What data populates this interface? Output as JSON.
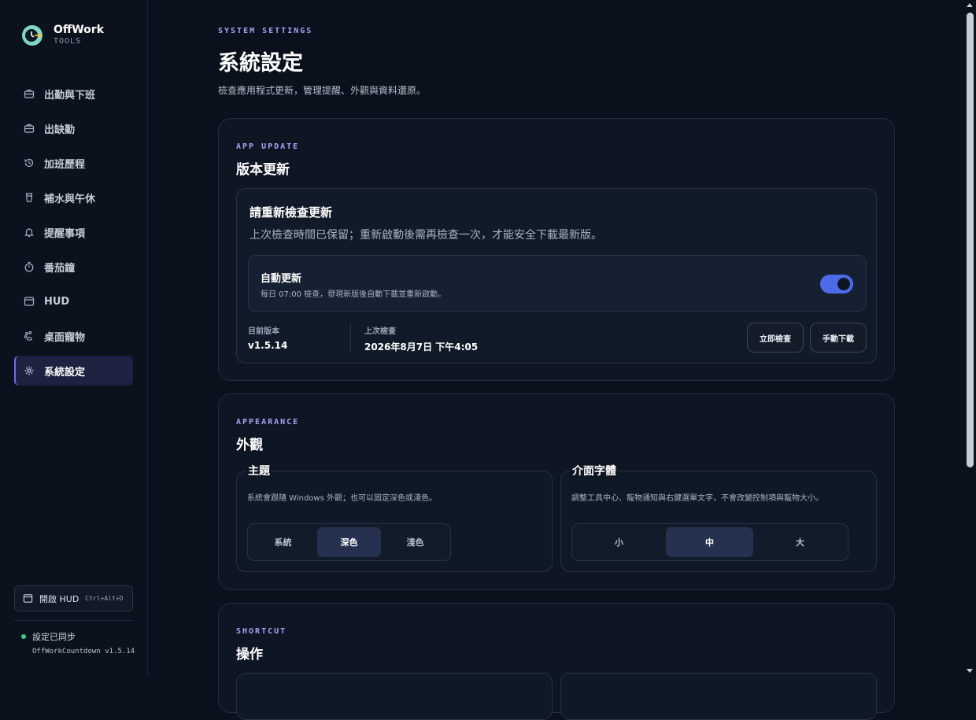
{
  "brand": {
    "name": "OffWork",
    "sub": "TOOLS"
  },
  "nav": [
    {
      "label": "出勤與下班",
      "icon": "briefcase-icon"
    },
    {
      "label": "出缺勤",
      "icon": "briefcase-icon"
    },
    {
      "label": "加班歷程",
      "icon": "history-icon"
    },
    {
      "label": "補水與午休",
      "icon": "cup-icon"
    },
    {
      "label": "提醒事項",
      "icon": "bell-icon"
    },
    {
      "label": "番茄鐘",
      "icon": "timer-icon"
    },
    {
      "label": "HUD",
      "icon": "window-icon"
    },
    {
      "label": "桌面寵物",
      "icon": "pet-icon"
    },
    {
      "label": "系統設定",
      "icon": "gear-icon",
      "active": true
    }
  ],
  "sidebar_footer": {
    "hud_label": "開啟 HUD",
    "hud_shortcut": "Ctrl+Alt+D",
    "sync_status": "設定已同步",
    "version": "OffWorkCountdown v1.5.14"
  },
  "page": {
    "eyebrow": "SYSTEM SETTINGS",
    "title": "系統設定",
    "description": "檢查應用程式更新，管理提醒、外觀與資料還原。"
  },
  "update": {
    "eyebrow": "APP UPDATE",
    "title": "版本更新",
    "notice_title": "請重新檢查更新",
    "notice_desc": "上次檢查時間已保留；重新啟動後需再檢查一次，才能安全下載最新版。",
    "auto_title": "自動更新",
    "auto_desc": "每日 07:00 檢查，發現新版後自動下載並重新啟動。",
    "auto_enabled": true,
    "current_label": "目前版本",
    "current_value": "v1.5.14",
    "last_label": "上次檢查",
    "last_value": "2026年8月7日 下午4:05",
    "check_button": "立即檢查",
    "download_button": "手動下載"
  },
  "appearance": {
    "eyebrow": "APPEARANCE",
    "title": "外觀",
    "theme": {
      "title": "主題",
      "desc": "系統會跟隨 Windows 外觀；也可以固定深色或淺色。",
      "options": [
        "系統",
        "深色",
        "淺色"
      ],
      "selected": "深色"
    },
    "font": {
      "title": "介面字體",
      "desc": "調整工具中心、寵物通知與右鍵選單文字，不會改變控制項與寵物大小。",
      "options": [
        "小",
        "中",
        "大"
      ],
      "selected": "中"
    }
  },
  "shortcut": {
    "eyebrow": "SHORTCUT",
    "title": "操作"
  },
  "colors": {
    "accent": "#6a6cf2",
    "toggle_on": "#4d6ae8",
    "eyebrow": "#a3a5f5",
    "sync_dot": "#35d08a"
  }
}
